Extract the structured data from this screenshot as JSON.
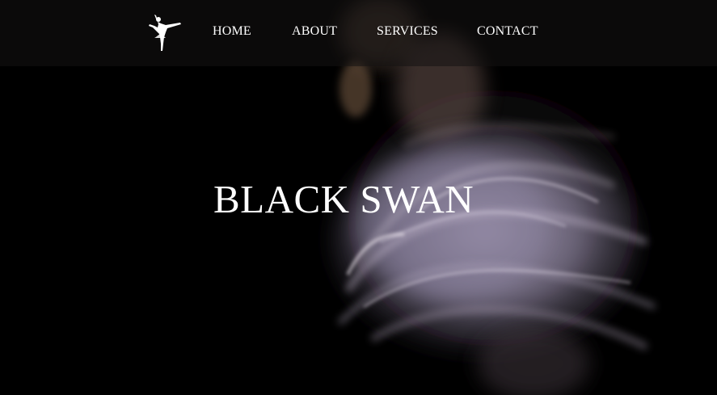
{
  "nav": {
    "logo_icon": "ballerina-icon",
    "items": [
      {
        "label": "HOME"
      },
      {
        "label": "ABOUT"
      },
      {
        "label": "SERVICES"
      },
      {
        "label": "CONTACT"
      }
    ]
  },
  "hero": {
    "title": "BLACK SWAN",
    "background": "motion-blurred-dancer-image"
  },
  "colors": {
    "background": "#000000",
    "text": "#ffffff",
    "navbar_overlay": "#141212"
  }
}
